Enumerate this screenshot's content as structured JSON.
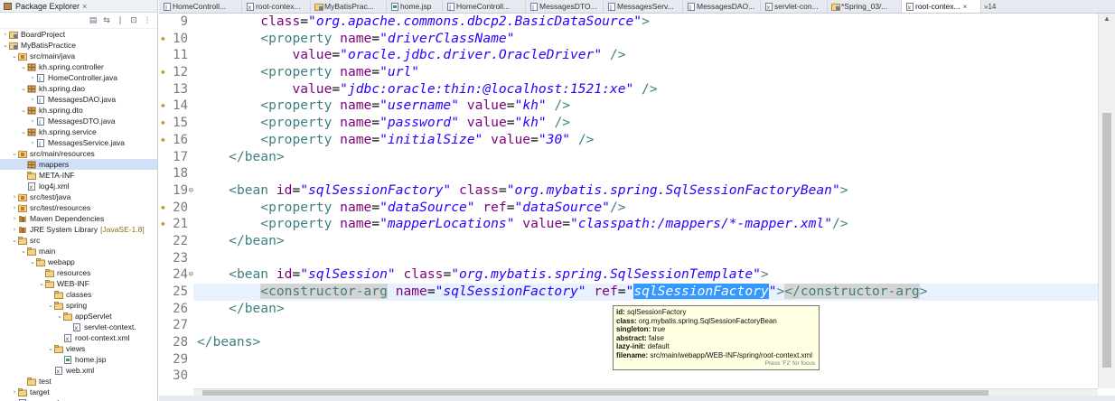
{
  "explorer": {
    "title": "Package Explorer",
    "tree": [
      {
        "label": "BoardProject",
        "indent": 0,
        "twisty": "right",
        "icon": "project-icon"
      },
      {
        "label": "MyBatisPractice",
        "indent": 0,
        "twisty": "down",
        "icon": "project-icon"
      },
      {
        "label": "src/main/java",
        "indent": 1,
        "twisty": "down",
        "icon": "source-folder-icon"
      },
      {
        "label": "kh.spring.controller",
        "indent": 2,
        "twisty": "down",
        "icon": "package-icon"
      },
      {
        "label": "HomeController.java",
        "indent": 3,
        "twisty": "right",
        "icon": "java-file-icon"
      },
      {
        "label": "kh.spring.dao",
        "indent": 2,
        "twisty": "down",
        "icon": "package-icon"
      },
      {
        "label": "MessagesDAO.java",
        "indent": 3,
        "twisty": "right",
        "icon": "java-file-icon"
      },
      {
        "label": "kh.spring.dto",
        "indent": 2,
        "twisty": "down",
        "icon": "package-icon"
      },
      {
        "label": "MessagesDTO.java",
        "indent": 3,
        "twisty": "right",
        "icon": "java-file-icon"
      },
      {
        "label": "kh.spring.service",
        "indent": 2,
        "twisty": "down",
        "icon": "package-icon"
      },
      {
        "label": "MessagesService.java",
        "indent": 3,
        "twisty": "right",
        "icon": "java-file-icon"
      },
      {
        "label": "src/main/resources",
        "indent": 1,
        "twisty": "down",
        "icon": "source-folder-icon"
      },
      {
        "label": "mappers",
        "indent": 2,
        "twisty": "",
        "icon": "package-icon",
        "selected": true
      },
      {
        "label": "META-INF",
        "indent": 2,
        "twisty": "",
        "icon": "folder-icon"
      },
      {
        "label": "log4j.xml",
        "indent": 2,
        "twisty": "",
        "icon": "xml-file-icon"
      },
      {
        "label": "src/test/java",
        "indent": 1,
        "twisty": "right",
        "icon": "source-folder-icon"
      },
      {
        "label": "src/test/resources",
        "indent": 1,
        "twisty": "right",
        "icon": "source-folder-icon"
      },
      {
        "label": "Maven Dependencies",
        "indent": 1,
        "twisty": "right",
        "icon": "library-icon"
      },
      {
        "label": "JRE System Library",
        "indent": 1,
        "twisty": "right",
        "icon": "library-icon",
        "suffix": "[JavaSE-1.8]"
      },
      {
        "label": "src",
        "indent": 1,
        "twisty": "down",
        "icon": "folder-icon"
      },
      {
        "label": "main",
        "indent": 2,
        "twisty": "down",
        "icon": "folder-icon"
      },
      {
        "label": "webapp",
        "indent": 3,
        "twisty": "down",
        "icon": "folder-icon"
      },
      {
        "label": "resources",
        "indent": 4,
        "twisty": "",
        "icon": "folder-icon"
      },
      {
        "label": "WEB-INF",
        "indent": 4,
        "twisty": "down",
        "icon": "folder-icon"
      },
      {
        "label": "classes",
        "indent": 5,
        "twisty": "",
        "icon": "folder-icon"
      },
      {
        "label": "spring",
        "indent": 5,
        "twisty": "down",
        "icon": "folder-icon"
      },
      {
        "label": "appServlet",
        "indent": 6,
        "twisty": "down",
        "icon": "folder-icon"
      },
      {
        "label": "servlet-context.",
        "indent": 7,
        "twisty": "",
        "icon": "xml-file-icon"
      },
      {
        "label": "root-context.xml",
        "indent": 6,
        "twisty": "",
        "icon": "xml-file-icon"
      },
      {
        "label": "views",
        "indent": 5,
        "twisty": "down",
        "icon": "folder-icon"
      },
      {
        "label": "home.jsp",
        "indent": 6,
        "twisty": "",
        "icon": "jsp-file-icon"
      },
      {
        "label": "web.xml",
        "indent": 5,
        "twisty": "",
        "icon": "xml-file-icon"
      },
      {
        "label": "test",
        "indent": 2,
        "twisty": "",
        "icon": "folder-icon"
      },
      {
        "label": "target",
        "indent": 1,
        "twisty": "right",
        "icon": "folder-icon"
      },
      {
        "label": "pom.xml",
        "indent": 1,
        "twisty": "",
        "icon": "xml-file-icon"
      }
    ]
  },
  "editor": {
    "tabs": [
      {
        "label": "HomeControll...",
        "icon": "java-file-icon"
      },
      {
        "label": "root-contex...",
        "icon": "xml-file-icon"
      },
      {
        "label": "MyBatisPrac...",
        "icon": "project-icon"
      },
      {
        "label": "home.jsp",
        "icon": "jsp-file-icon"
      },
      {
        "label": "HomeControll...",
        "icon": "java-file-icon"
      },
      {
        "label": "MessagesDTO...",
        "icon": "java-file-icon"
      },
      {
        "label": "MessagesServ...",
        "icon": "java-file-icon"
      },
      {
        "label": "MessagesDAO...",
        "icon": "java-file-icon"
      },
      {
        "label": "servlet-con...",
        "icon": "xml-file-icon"
      },
      {
        "label": "*Spring_03/...",
        "icon": "project-icon"
      },
      {
        "label": "root-contex...",
        "icon": "xml-file-icon",
        "active": true
      }
    ],
    "tab_overflow": "»14",
    "lines": [
      {
        "n": "9",
        "marker": false,
        "fold": false,
        "tokens": [
          {
            "t": "        ",
            "c": ""
          },
          {
            "t": "class",
            "c": "attr"
          },
          {
            "t": "=",
            "c": ""
          },
          {
            "t": "\"org.apache.commons.dbcp2.BasicDataSource\"",
            "c": "val"
          },
          {
            "t": ">",
            "c": "tag"
          }
        ]
      },
      {
        "n": "10",
        "marker": true,
        "fold": false,
        "tokens": [
          {
            "t": "        ",
            "c": ""
          },
          {
            "t": "<property",
            "c": "tag"
          },
          {
            "t": " ",
            "c": ""
          },
          {
            "t": "name",
            "c": "attr"
          },
          {
            "t": "=",
            "c": ""
          },
          {
            "t": "\"driverClassName\"",
            "c": "val"
          }
        ]
      },
      {
        "n": "11",
        "marker": false,
        "fold": false,
        "tokens": [
          {
            "t": "            ",
            "c": ""
          },
          {
            "t": "value",
            "c": "attr"
          },
          {
            "t": "=",
            "c": ""
          },
          {
            "t": "\"oracle.jdbc.driver.OracleDriver\"",
            "c": "val"
          },
          {
            "t": " />",
            "c": "tag"
          }
        ]
      },
      {
        "n": "12",
        "marker": true,
        "fold": false,
        "tokens": [
          {
            "t": "        ",
            "c": ""
          },
          {
            "t": "<property",
            "c": "tag"
          },
          {
            "t": " ",
            "c": ""
          },
          {
            "t": "name",
            "c": "attr"
          },
          {
            "t": "=",
            "c": ""
          },
          {
            "t": "\"url\"",
            "c": "val"
          }
        ]
      },
      {
        "n": "13",
        "marker": false,
        "fold": false,
        "tokens": [
          {
            "t": "            ",
            "c": ""
          },
          {
            "t": "value",
            "c": "attr"
          },
          {
            "t": "=",
            "c": ""
          },
          {
            "t": "\"jdbc:oracle:thin:@localhost:1521:xe\"",
            "c": "val"
          },
          {
            "t": " />",
            "c": "tag"
          }
        ]
      },
      {
        "n": "14",
        "marker": true,
        "fold": false,
        "tokens": [
          {
            "t": "        ",
            "c": ""
          },
          {
            "t": "<property",
            "c": "tag"
          },
          {
            "t": " ",
            "c": ""
          },
          {
            "t": "name",
            "c": "attr"
          },
          {
            "t": "=",
            "c": ""
          },
          {
            "t": "\"username\"",
            "c": "val"
          },
          {
            "t": " ",
            "c": ""
          },
          {
            "t": "value",
            "c": "attr"
          },
          {
            "t": "=",
            "c": ""
          },
          {
            "t": "\"kh\"",
            "c": "val"
          },
          {
            "t": " />",
            "c": "tag"
          }
        ]
      },
      {
        "n": "15",
        "marker": true,
        "fold": false,
        "tokens": [
          {
            "t": "        ",
            "c": ""
          },
          {
            "t": "<property",
            "c": "tag"
          },
          {
            "t": " ",
            "c": ""
          },
          {
            "t": "name",
            "c": "attr"
          },
          {
            "t": "=",
            "c": ""
          },
          {
            "t": "\"password\"",
            "c": "val"
          },
          {
            "t": " ",
            "c": ""
          },
          {
            "t": "value",
            "c": "attr"
          },
          {
            "t": "=",
            "c": ""
          },
          {
            "t": "\"kh\"",
            "c": "val"
          },
          {
            "t": " />",
            "c": "tag"
          }
        ]
      },
      {
        "n": "16",
        "marker": true,
        "fold": false,
        "tokens": [
          {
            "t": "        ",
            "c": ""
          },
          {
            "t": "<property",
            "c": "tag"
          },
          {
            "t": " ",
            "c": ""
          },
          {
            "t": "name",
            "c": "attr"
          },
          {
            "t": "=",
            "c": ""
          },
          {
            "t": "\"initialSize\"",
            "c": "val"
          },
          {
            "t": " ",
            "c": ""
          },
          {
            "t": "value",
            "c": "attr"
          },
          {
            "t": "=",
            "c": ""
          },
          {
            "t": "\"30\"",
            "c": "val"
          },
          {
            "t": " />",
            "c": "tag"
          }
        ]
      },
      {
        "n": "17",
        "marker": false,
        "fold": false,
        "tokens": [
          {
            "t": "    ",
            "c": ""
          },
          {
            "t": "</bean>",
            "c": "tag"
          }
        ]
      },
      {
        "n": "18",
        "marker": false,
        "fold": false,
        "tokens": []
      },
      {
        "n": "19",
        "marker": false,
        "fold": true,
        "tokens": [
          {
            "t": "    ",
            "c": ""
          },
          {
            "t": "<bean",
            "c": "tag"
          },
          {
            "t": " ",
            "c": ""
          },
          {
            "t": "id",
            "c": "attr"
          },
          {
            "t": "=",
            "c": ""
          },
          {
            "t": "\"sqlSessionFactory\"",
            "c": "val"
          },
          {
            "t": " ",
            "c": ""
          },
          {
            "t": "class",
            "c": "attr"
          },
          {
            "t": "=",
            "c": ""
          },
          {
            "t": "\"org.mybatis.spring.SqlSessionFactoryBean\"",
            "c": "val"
          },
          {
            "t": ">",
            "c": "tag"
          }
        ]
      },
      {
        "n": "20",
        "marker": true,
        "fold": false,
        "tokens": [
          {
            "t": "        ",
            "c": ""
          },
          {
            "t": "<property",
            "c": "tag"
          },
          {
            "t": " ",
            "c": ""
          },
          {
            "t": "name",
            "c": "attr"
          },
          {
            "t": "=",
            "c": ""
          },
          {
            "t": "\"dataSource\"",
            "c": "val"
          },
          {
            "t": " ",
            "c": ""
          },
          {
            "t": "ref",
            "c": "attr"
          },
          {
            "t": "=",
            "c": ""
          },
          {
            "t": "\"dataSource\"",
            "c": "val"
          },
          {
            "t": "/>",
            "c": "tag"
          }
        ]
      },
      {
        "n": "21",
        "marker": true,
        "fold": false,
        "tokens": [
          {
            "t": "        ",
            "c": ""
          },
          {
            "t": "<property",
            "c": "tag"
          },
          {
            "t": " ",
            "c": ""
          },
          {
            "t": "name",
            "c": "attr"
          },
          {
            "t": "=",
            "c": ""
          },
          {
            "t": "\"mapperLocations\"",
            "c": "val"
          },
          {
            "t": " ",
            "c": ""
          },
          {
            "t": "value",
            "c": "attr"
          },
          {
            "t": "=",
            "c": ""
          },
          {
            "t": "\"classpath:/mappers/*-mapper.xml\"",
            "c": "val"
          },
          {
            "t": "/>",
            "c": "tag"
          }
        ]
      },
      {
        "n": "22",
        "marker": false,
        "fold": false,
        "tokens": [
          {
            "t": "    ",
            "c": ""
          },
          {
            "t": "</bean>",
            "c": "tag"
          }
        ]
      },
      {
        "n": "23",
        "marker": false,
        "fold": false,
        "tokens": []
      },
      {
        "n": "24",
        "marker": false,
        "fold": true,
        "tokens": [
          {
            "t": "    ",
            "c": ""
          },
          {
            "t": "<bean",
            "c": "tag"
          },
          {
            "t": " ",
            "c": ""
          },
          {
            "t": "id",
            "c": "attr"
          },
          {
            "t": "=",
            "c": ""
          },
          {
            "t": "\"sqlSession\"",
            "c": "val"
          },
          {
            "t": " ",
            "c": ""
          },
          {
            "t": "class",
            "c": "attr"
          },
          {
            "t": "=",
            "c": ""
          },
          {
            "t": "\"org.mybatis.spring.SqlSessionTemplate\"",
            "c": "val"
          },
          {
            "t": ">",
            "c": "tag"
          }
        ]
      },
      {
        "n": "25",
        "marker": false,
        "fold": false,
        "current": true,
        "tokens": [
          {
            "t": "        ",
            "c": ""
          },
          {
            "t": "<constructor-arg",
            "c": "tag match"
          },
          {
            "t": " ",
            "c": ""
          },
          {
            "t": "name",
            "c": "attr"
          },
          {
            "t": "=",
            "c": ""
          },
          {
            "t": "\"sqlSessionFactory\"",
            "c": "val"
          },
          {
            "t": " ",
            "c": ""
          },
          {
            "t": "ref",
            "c": "attr"
          },
          {
            "t": "=",
            "c": ""
          },
          {
            "t": "\"",
            "c": "val"
          },
          {
            "t": "sqlSessionFactory",
            "c": "val sel"
          },
          {
            "t": "\"",
            "c": "val"
          },
          {
            "t": ">",
            "c": "tag"
          },
          {
            "t": "</constructor-arg",
            "c": "tag match"
          },
          {
            "t": ">",
            "c": "tag"
          }
        ]
      },
      {
        "n": "26",
        "marker": false,
        "fold": false,
        "tokens": [
          {
            "t": "    ",
            "c": ""
          },
          {
            "t": "</bean>",
            "c": "tag"
          }
        ]
      },
      {
        "n": "27",
        "marker": false,
        "fold": false,
        "tokens": []
      },
      {
        "n": "28",
        "marker": false,
        "fold": false,
        "tokens": [
          {
            "t": "</beans>",
            "c": "tag"
          }
        ]
      },
      {
        "n": "29",
        "marker": false,
        "fold": false,
        "tokens": []
      },
      {
        "n": "30",
        "marker": false,
        "fold": false,
        "tokens": []
      }
    ]
  },
  "tooltip": {
    "rows": [
      {
        "key": "id:",
        "value": " sqlSessionFactory"
      },
      {
        "key": "class:",
        "value": " org.mybatis.spring.SqlSessionFactoryBean"
      },
      {
        "key": "singleton:",
        "value": " true"
      },
      {
        "key": "abstract:",
        "value": " false"
      },
      {
        "key": "lazy-init:",
        "value": " default"
      },
      {
        "key": "filename:",
        "value": " src/main/webapp/WEB-INF/spring/root-context.xml"
      }
    ],
    "hint": "Press 'F2' for focus"
  }
}
